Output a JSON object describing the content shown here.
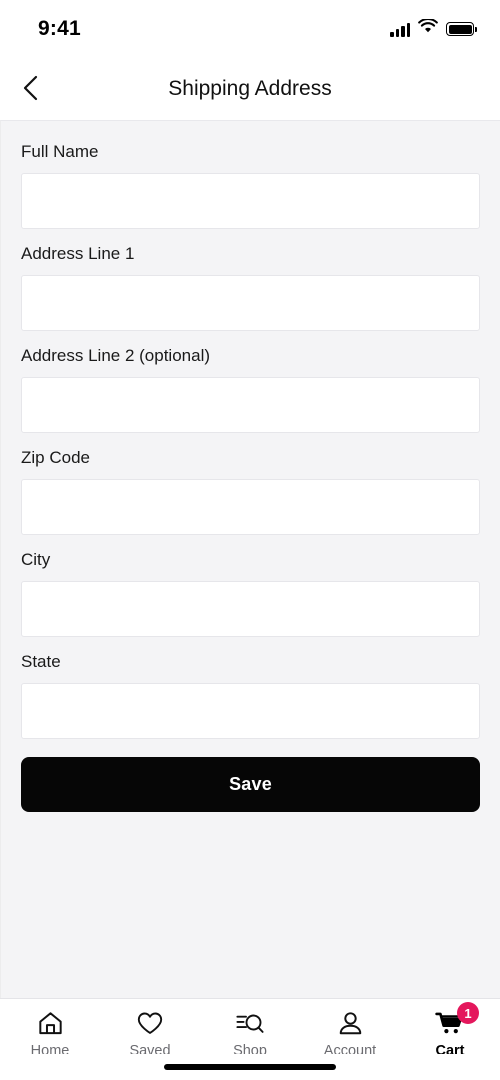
{
  "status_bar": {
    "time": "9:41",
    "signal_icon": "signal-bars-icon",
    "wifi_icon": "wifi-icon",
    "battery_icon": "battery-icon"
  },
  "header": {
    "back_icon": "chevron-left-icon",
    "title": "Shipping Address"
  },
  "form": {
    "fields": [
      {
        "label": "Full Name",
        "value": "",
        "placeholder": ""
      },
      {
        "label": "Address Line 1",
        "value": "",
        "placeholder": ""
      },
      {
        "label": "Address Line 2 (optional)",
        "value": "",
        "placeholder": ""
      },
      {
        "label": "Zip Code",
        "value": "",
        "placeholder": ""
      },
      {
        "label": "City",
        "value": "",
        "placeholder": ""
      },
      {
        "label": "State",
        "value": "",
        "placeholder": ""
      }
    ],
    "save_label": "Save"
  },
  "tab_bar": {
    "items": [
      {
        "label": "Home",
        "icon": "home-icon",
        "active": false,
        "badge": ""
      },
      {
        "label": "Saved",
        "icon": "heart-icon",
        "active": false,
        "badge": ""
      },
      {
        "label": "Shop",
        "icon": "search-filter-icon",
        "active": false,
        "badge": ""
      },
      {
        "label": "Account",
        "icon": "person-icon",
        "active": false,
        "badge": ""
      },
      {
        "label": "Cart",
        "icon": "cart-icon",
        "active": true,
        "badge": "1"
      }
    ]
  },
  "colors": {
    "badge": "#e4175c",
    "button": "#060606",
    "background": "#f4f4f6",
    "inactive_label": "#6b6b70"
  }
}
